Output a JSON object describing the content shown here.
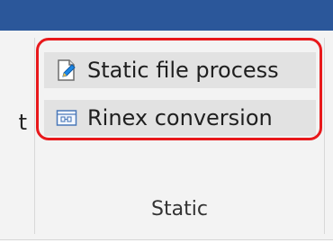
{
  "ribbon": {
    "prev_group_tail": "t",
    "group": {
      "label": "Static",
      "commands": [
        {
          "label": "Static file process",
          "icon": "edit-document-icon"
        },
        {
          "label": "Rinex conversion",
          "icon": "rinex-convert-icon"
        }
      ]
    }
  },
  "colors": {
    "titlebar": "#2b579a",
    "highlight": "#e8181b",
    "command_background": "#e2e2e2"
  }
}
